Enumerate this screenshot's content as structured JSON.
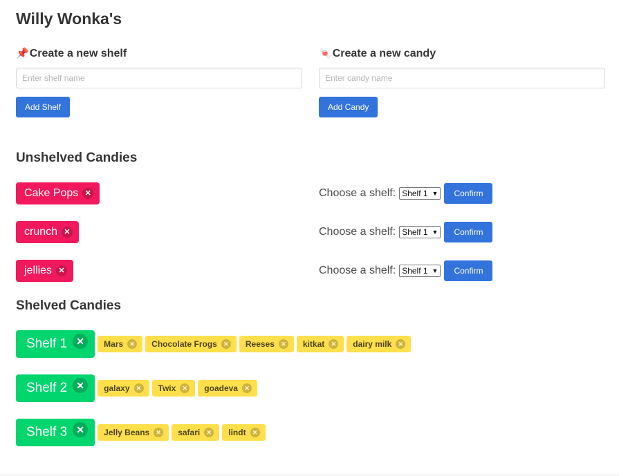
{
  "app": {
    "title": "Willy Wonka's"
  },
  "shelf_form": {
    "emoji": "📌",
    "heading": "Create a new shelf",
    "placeholder": "Enter shelf name",
    "button_label": "Add Shelf"
  },
  "candy_form": {
    "emoji": "🍬",
    "heading": "Create a new candy",
    "placeholder": "Enter candy name",
    "button_label": "Add Candy"
  },
  "unshelved": {
    "title": "Unshelved Candies",
    "choose_label": "Choose a shelf:",
    "confirm_label": "Confirm",
    "items": [
      {
        "name": "Cake Pops",
        "selected_shelf": "Shelf 1"
      },
      {
        "name": "crunch",
        "selected_shelf": "Shelf 1"
      },
      {
        "name": "jellies",
        "selected_shelf": "Shelf 1"
      }
    ]
  },
  "shelved": {
    "title": "Shelved Candies",
    "shelves": [
      {
        "name": "Shelf 1",
        "candies": [
          "Mars",
          "Chocolate Frogs",
          "Reeses",
          "kitkat",
          "dairy milk"
        ]
      },
      {
        "name": "Shelf 2",
        "candies": [
          "galaxy",
          "Twix",
          "goadeva"
        ]
      },
      {
        "name": "Shelf 3",
        "candies": [
          "Jelly Beans",
          "safari",
          "lindt"
        ]
      }
    ]
  },
  "icons": {
    "delete": "close-circle-icon",
    "dropdown": "chevron-down-icon"
  },
  "colors": {
    "primary": "#3273dc",
    "candy_tag": "#f1185d",
    "shelf_tag": "#00d56e",
    "shelved_candy": "#ffdf4c"
  }
}
